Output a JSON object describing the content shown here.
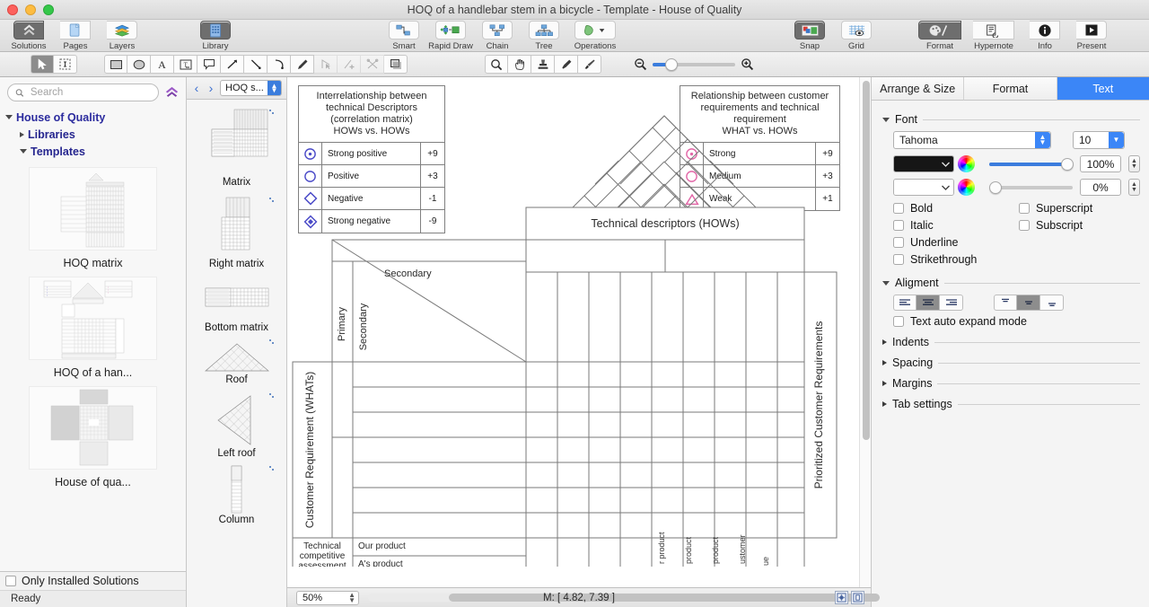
{
  "window": {
    "title": "HOQ of a handlebar stem in a bicycle - Template - House of Quality",
    "traffic": [
      "close",
      "minimize",
      "zoom"
    ]
  },
  "toolbar": {
    "groups": [
      {
        "name": "solutions-group",
        "items": [
          {
            "label": "Solutions",
            "icon": "solutions-icon",
            "active": true
          },
          {
            "label": "Pages",
            "icon": "pages-icon",
            "active": false
          },
          {
            "label": "Layers",
            "icon": "layers-icon",
            "active": false
          }
        ]
      },
      {
        "name": "library-group",
        "items": [
          {
            "label": "Library",
            "icon": "library-icon",
            "active": true
          }
        ]
      },
      {
        "name": "connector-group",
        "items": [
          {
            "label": "Smart",
            "icon": "smart-connector-icon",
            "active": false
          },
          {
            "label": "Rapid Draw",
            "icon": "rapid-draw-icon",
            "active": false
          },
          {
            "label": "Chain",
            "icon": "chain-icon",
            "active": false
          },
          {
            "label": "Tree",
            "icon": "tree-icon",
            "active": false
          },
          {
            "label": "Operations",
            "icon": "operations-icon",
            "active": false
          }
        ]
      },
      {
        "name": "view-group",
        "items": [
          {
            "label": "Snap",
            "icon": "snap-icon",
            "active": true
          },
          {
            "label": "Grid",
            "icon": "grid-icon",
            "active": false
          }
        ]
      },
      {
        "name": "inspector-group",
        "items": [
          {
            "label": "Format",
            "icon": "format-palette-icon",
            "active": true
          },
          {
            "label": "Hypernote",
            "icon": "hypernote-icon",
            "active": false
          },
          {
            "label": "Info",
            "icon": "info-icon",
            "active": false
          },
          {
            "label": "Present",
            "icon": "present-icon",
            "active": false
          }
        ]
      }
    ]
  },
  "tools": {
    "select_group": [
      "pointer-tool",
      "marquee-select-tool"
    ],
    "draw_group": [
      "rectangle-tool",
      "ellipse-tool",
      "text-tool",
      "text-block-tool",
      "callout-tool",
      "arrow-tool",
      "line-tool",
      "arc-tool",
      "pen-tool",
      "edit-points-tool",
      "add-point-tool",
      "cut-path-tool",
      "shadow-tool"
    ],
    "view_group": [
      "zoom-tool",
      "hand-tool",
      "stamp-tool",
      "eyedropper-tool",
      "paintbrush-tool"
    ],
    "zoom_slider": {
      "min_icon": "zoom-out-icon",
      "max_icon": "zoom-in-icon",
      "value": 17
    }
  },
  "sidebar": {
    "search": {
      "placeholder": "Search",
      "value": ""
    },
    "solutions_icon": "solutions-badge-icon",
    "tree": [
      {
        "label": "House of Quality",
        "level": 0,
        "expanded": true
      },
      {
        "label": "Libraries",
        "level": 1,
        "expanded": false
      },
      {
        "label": "Templates",
        "level": 1,
        "expanded": true
      }
    ],
    "templates": [
      {
        "caption": "HOQ matrix",
        "thumb": "hoq-matrix-thumb"
      },
      {
        "caption": "HOQ of a han...",
        "thumb": "hoq-handlebar-thumb"
      },
      {
        "caption": "House of qua...",
        "thumb": "house-of-quality-thumb"
      }
    ],
    "only_installed": {
      "label": "Only Installed Solutions",
      "checked": false
    },
    "status": "Ready"
  },
  "shapes_panel": {
    "back_icon": "chevron-left-icon",
    "forward_icon": "chevron-right-icon",
    "library_name": "HOQ s...",
    "items": [
      {
        "name": "Matrix",
        "icon": "matrix-shape"
      },
      {
        "name": "Right matrix",
        "icon": "right-matrix-shape"
      },
      {
        "name": "Bottom matrix",
        "icon": "bottom-matrix-shape"
      },
      {
        "name": "Roof",
        "icon": "roof-shape"
      },
      {
        "name": "Left roof",
        "icon": "left-roof-shape"
      },
      {
        "name": "Column",
        "icon": "column-shape"
      }
    ]
  },
  "canvas": {
    "legend_left": {
      "title": "Interrelationship between technical Descriptors (correlation matrix) HOWs vs. HOWs",
      "title_lines": [
        "Interrelationship between",
        "technical Descriptors",
        "(correlation matrix)",
        "HOWs vs. HOWs"
      ],
      "color": "#4b4bc8",
      "rows": [
        {
          "symbol": "circle-dot-icon",
          "label": "Strong positive",
          "value": "+9"
        },
        {
          "symbol": "circle-icon",
          "label": "Positive",
          "value": "+3"
        },
        {
          "symbol": "diamond-icon",
          "label": "Negative",
          "value": "-1"
        },
        {
          "symbol": "diamond-dot-icon",
          "label": "Strong negative",
          "value": "-9"
        }
      ]
    },
    "legend_right": {
      "title": "Relationship between customer requirements and technical requirement WHAT vs. HOWs",
      "title_lines": [
        "Relationship between customer",
        "requirements and technical",
        "requirement",
        "WHAT vs. HOWs"
      ],
      "color": "#e268a8",
      "rows": [
        {
          "symbol": "circle-dot-icon",
          "label": "Strong",
          "value": "+9"
        },
        {
          "symbol": "circle-icon",
          "label": "Medium",
          "value": "+3"
        },
        {
          "symbol": "triangle-icon",
          "label": "Weak",
          "value": "+1"
        }
      ]
    },
    "roof_label": "Technical descriptors (HOWs)",
    "primary_label": "Primary",
    "secondary_label_v": "Secondary",
    "secondary_label_h": "Secondary",
    "whats_label": "Customer Requirement (WHATs)",
    "prioritized_label": "Prioritized Customer Requirements",
    "tech_assessment_lines": [
      "Technical",
      "competitive",
      "assessment"
    ],
    "assessment_rows": [
      "Our product",
      "A's product"
    ],
    "bottom_vertical_labels": [
      "Our product",
      "A's product",
      "B's product",
      "Customer",
      "...ue"
    ]
  },
  "bottom_bar": {
    "zoom": "50%",
    "coords": "M: [ 4.82, 7.39 ]",
    "buttons": [
      "fit-to-window-icon",
      "actual-size-icon"
    ]
  },
  "inspector": {
    "tabs": [
      {
        "label": "Arrange & Size",
        "active": false
      },
      {
        "label": "Format",
        "active": false
      },
      {
        "label": "Text",
        "active": true
      }
    ],
    "font_section": {
      "label": "Font",
      "family": "Tahoma",
      "size": "10",
      "fill_color": "#161616",
      "fill_opacity": "100%",
      "stroke_color": "#ffffff",
      "stroke_opacity": "0%"
    },
    "style_checkboxes": [
      {
        "label": "Bold",
        "checked": false
      },
      {
        "label": "Superscript",
        "checked": false
      },
      {
        "label": "Italic",
        "checked": false
      },
      {
        "label": "Subscript",
        "checked": false
      },
      {
        "label": "Underline",
        "checked": false
      },
      {
        "label": "Strikethrough",
        "checked": false
      }
    ],
    "alignment_section": {
      "label": "Aligment",
      "horizontal": [
        "align-left-icon",
        "align-center-icon",
        "align-right-icon"
      ],
      "horizontal_active": 1,
      "vertical": [
        "align-top-icon",
        "align-middle-icon",
        "align-bottom-icon"
      ],
      "vertical_active": 1,
      "auto_expand": {
        "label": "Text auto expand mode",
        "checked": false
      }
    },
    "collapsed_sections": [
      "Indents",
      "Spacing",
      "Margins",
      "Tab settings"
    ]
  }
}
